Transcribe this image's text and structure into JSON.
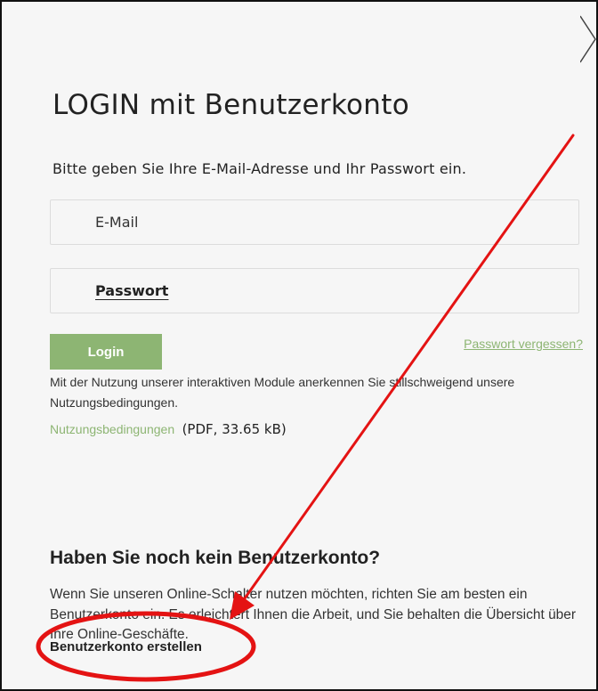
{
  "title": {
    "prefix": "LOGIN",
    "suffix": "mit Benutzerkonto"
  },
  "instruction": "Bitte geben Sie Ihre E-Mail-Adresse und Ihr Passwort ein.",
  "fields": {
    "email_placeholder": "E-Mail",
    "password_placeholder": "Passwort"
  },
  "buttons": {
    "login": "Login",
    "forgot_password": "Passwort vergessen?"
  },
  "terms": {
    "text": "Mit der Nutzung unserer interaktiven Module anerkennen Sie stillschweigend unsere Nutzungsbedingungen.",
    "link_label": "Nutzungsbedingungen",
    "file_meta": "(PDF, 33.65 kB)"
  },
  "register": {
    "heading": "Haben Sie noch kein Benutzerkonto?",
    "description": "Wenn Sie unseren Online-Schalter nutzen möchten, richten Sie am besten ein Benutzerkonto ein. Es erleichtert Ihnen die Arbeit, und Sie behalten die Übersicht über Ihre Online-Geschäfte.",
    "create_link": "Benutzerkonto erstellen"
  },
  "icons": {
    "close": "close-icon"
  },
  "colors": {
    "accent": "#8db573",
    "annotation": "#e41313",
    "background": "#f6f6f6"
  }
}
